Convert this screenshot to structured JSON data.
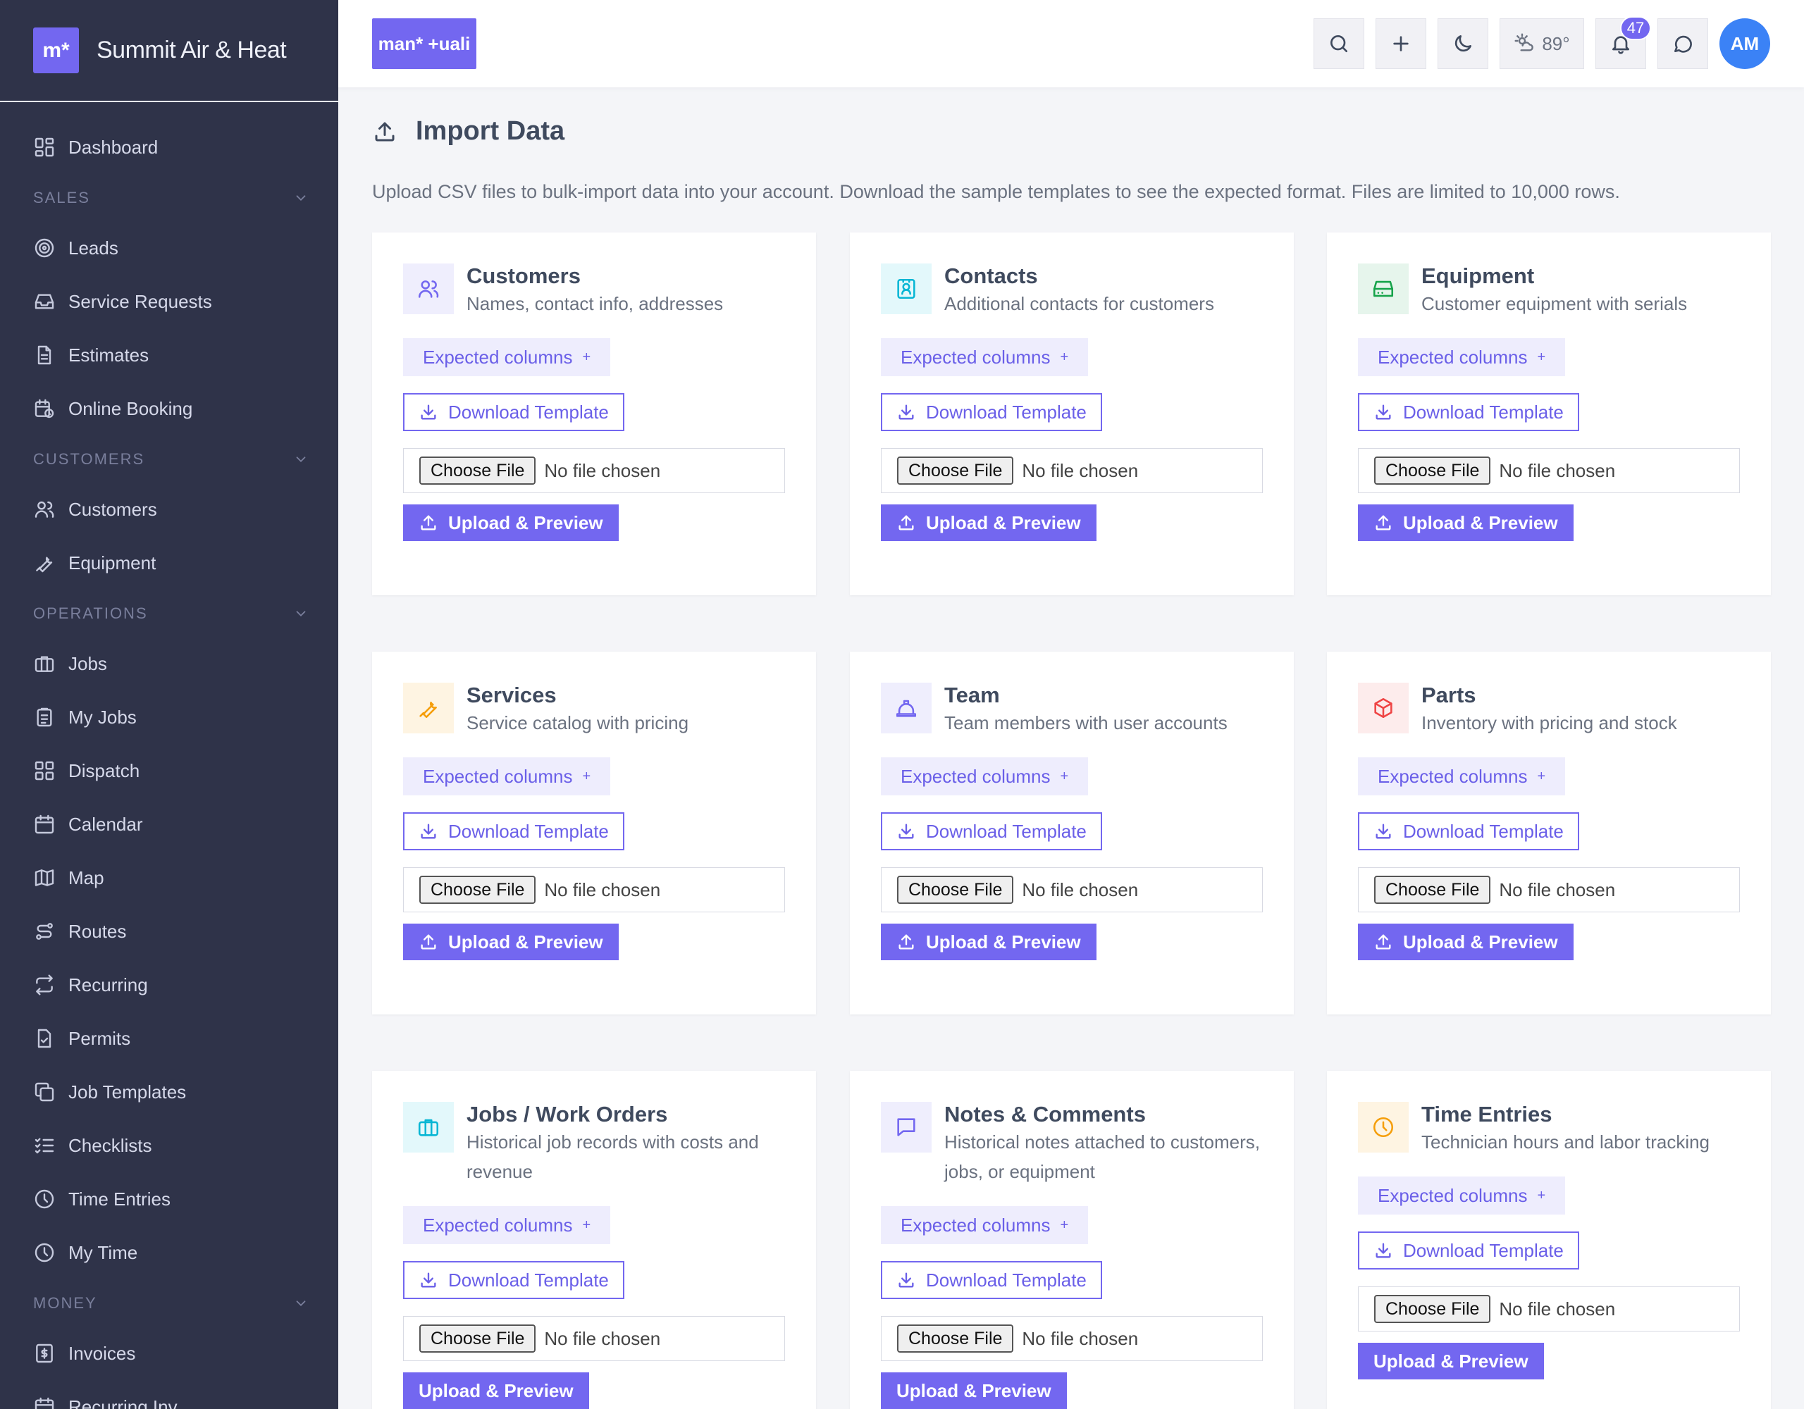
{
  "app": {
    "name": "Summit Air & Heat",
    "logo_text": "m*",
    "top_logo_text": "man* +uali"
  },
  "sidebar": {
    "items_top": [
      {
        "label": "Dashboard",
        "icon": "dashboard-icon"
      }
    ],
    "sections": [
      {
        "title": "SALES",
        "items": [
          {
            "label": "Leads",
            "icon": "target-icon"
          },
          {
            "label": "Service Requests",
            "icon": "inbox-icon"
          },
          {
            "label": "Estimates",
            "icon": "document-icon"
          },
          {
            "label": "Online Booking",
            "icon": "calendar-clock-icon"
          }
        ]
      },
      {
        "title": "CUSTOMERS",
        "items": [
          {
            "label": "Customers",
            "icon": "users-icon"
          },
          {
            "label": "Equipment",
            "icon": "wrench-icon"
          }
        ]
      },
      {
        "title": "OPERATIONS",
        "items": [
          {
            "label": "Jobs",
            "icon": "briefcase-icon"
          },
          {
            "label": "My Jobs",
            "icon": "clipboard-icon"
          },
          {
            "label": "Dispatch",
            "icon": "grid-icon"
          },
          {
            "label": "Calendar",
            "icon": "calendar-icon"
          },
          {
            "label": "Map",
            "icon": "map-icon"
          },
          {
            "label": "Routes",
            "icon": "route-icon"
          },
          {
            "label": "Recurring",
            "icon": "repeat-icon"
          },
          {
            "label": "Permits",
            "icon": "permit-icon"
          },
          {
            "label": "Job Templates",
            "icon": "copy-icon"
          },
          {
            "label": "Checklists",
            "icon": "checklist-icon"
          },
          {
            "label": "Time Entries",
            "icon": "clock-icon"
          },
          {
            "label": "My Time",
            "icon": "clock-icon"
          }
        ]
      },
      {
        "title": "MONEY",
        "items": [
          {
            "label": "Invoices",
            "icon": "invoice-icon"
          },
          {
            "label": "Recurring Inv.",
            "icon": "calendar-icon"
          }
        ]
      }
    ]
  },
  "topbar": {
    "weather": "89°",
    "notifications_count": "47",
    "avatar_initials": "AM"
  },
  "page": {
    "title": "Import Data",
    "description": "Upload CSV files to bulk-import data into your account. Download the sample templates to see the expected format. Files are limited to 10,000 rows."
  },
  "labels": {
    "expected_columns": "Expected columns",
    "plus": "+",
    "download_template": "Download Template",
    "choose_file": "Choose File",
    "no_file": "No file chosen",
    "upload_preview": "Upload & Preview"
  },
  "cards": [
    {
      "title": "Customers",
      "subtitle": "Names, contact info, addresses",
      "icon": "users-icon",
      "color": "#7367f0",
      "bg": "#efeefd"
    },
    {
      "title": "Contacts",
      "subtitle": "Additional contacts for customers",
      "icon": "contact-card-icon",
      "color": "#06b6d4",
      "bg": "#e3f8fb"
    },
    {
      "title": "Equipment",
      "subtitle": "Customer equipment with serials",
      "icon": "hard-drive-icon",
      "color": "#16a34a",
      "bg": "#e6f5ec"
    },
    {
      "title": "Services",
      "subtitle": "Service catalog with pricing",
      "icon": "wrench-icon",
      "color": "#f59e0b",
      "bg": "#fef4e2"
    },
    {
      "title": "Team",
      "subtitle": "Team members with user accounts",
      "icon": "hard-hat-icon",
      "color": "#7367f0",
      "bg": "#efeefd"
    },
    {
      "title": "Parts",
      "subtitle": "Inventory with pricing and stock",
      "icon": "box-icon",
      "color": "#ef4444",
      "bg": "#fdecec"
    },
    {
      "title": "Jobs / Work Orders",
      "subtitle": "Historical job records with costs and revenue",
      "icon": "briefcase-icon",
      "color": "#06b6d4",
      "bg": "#e3f8fb"
    },
    {
      "title": "Notes & Comments",
      "subtitle": "Historical notes attached to customers, jobs, or equipment",
      "icon": "message-icon",
      "color": "#7367f0",
      "bg": "#efeefd"
    },
    {
      "title": "Time Entries",
      "subtitle": "Technician hours and labor tracking",
      "icon": "clock-icon",
      "color": "#f59e0b",
      "bg": "#fef4e2"
    }
  ]
}
